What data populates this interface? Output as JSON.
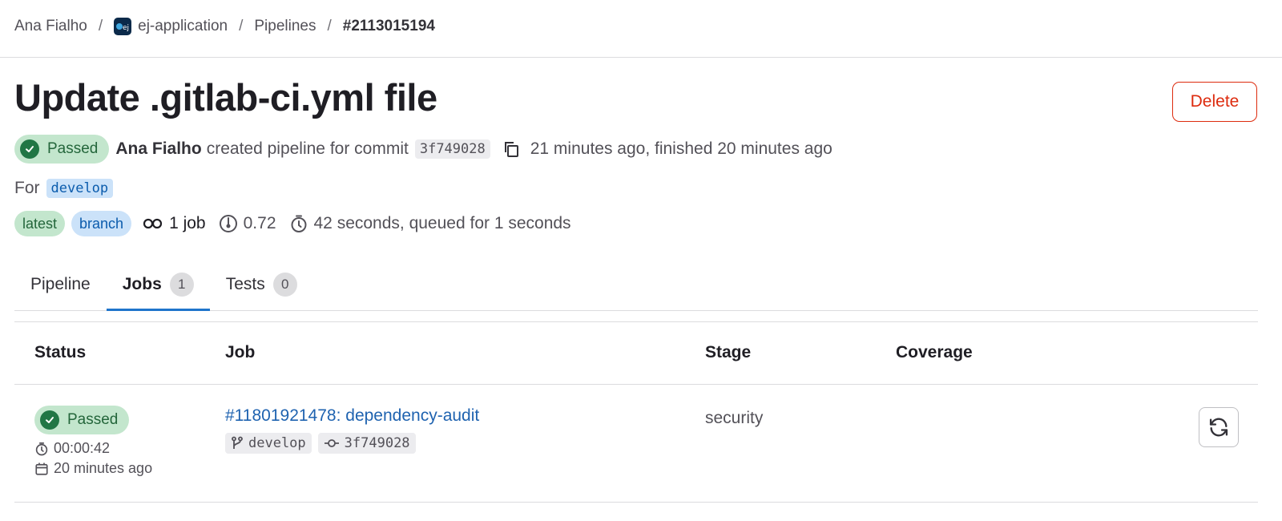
{
  "breadcrumb": {
    "items": [
      "Ana Fialho",
      "ej-application",
      "Pipelines",
      "#2113015194"
    ],
    "separator": "/",
    "project_avatar_text": "ej"
  },
  "header": {
    "title": "Update .gitlab-ci.yml file",
    "delete_label": "Delete"
  },
  "meta": {
    "status": "Passed",
    "author": "Ana Fialho",
    "created_text": "created pipeline for commit",
    "commit_sha": "3f749028",
    "time_text": "21 minutes ago, finished 20 minutes ago"
  },
  "ref": {
    "for_label": "For",
    "branch": "develop"
  },
  "badges": {
    "latest": "latest",
    "branch": "branch",
    "jobs": "1 job",
    "compute": "0.72",
    "duration": "42 seconds, queued for 1 seconds"
  },
  "tabs": [
    {
      "label": "Pipeline",
      "count": null
    },
    {
      "label": "Jobs",
      "count": "1"
    },
    {
      "label": "Tests",
      "count": "0"
    }
  ],
  "table": {
    "headers": [
      "Status",
      "Job",
      "Stage",
      "Coverage"
    ],
    "rows": [
      {
        "status": "Passed",
        "duration": "00:00:42",
        "finished": "20 minutes ago",
        "job": "#11801921478: dependency-audit",
        "branch": "develop",
        "commit": "3f749028",
        "stage": "security",
        "coverage": ""
      }
    ]
  },
  "colors": {
    "success_bg": "#c3e6cd",
    "success_fg": "#217645",
    "danger": "#dd2b0e",
    "link": "#1f63b0",
    "tab_active": "#1f75cb"
  }
}
